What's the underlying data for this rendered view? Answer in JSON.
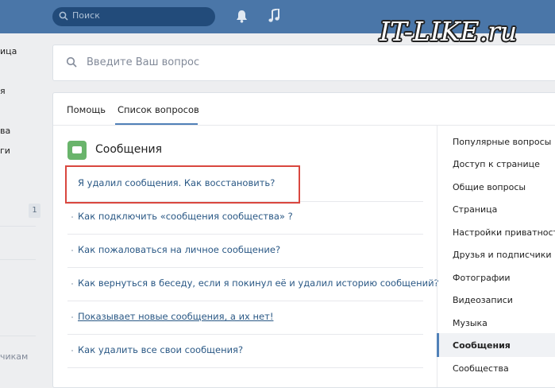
{
  "header": {
    "search_placeholder": "Поиск",
    "icons": [
      "search-icon",
      "bell-icon",
      "music-icon"
    ],
    "watermark": "IT-LIKE.ru"
  },
  "leftnav": {
    "fragments": [
      "ица",
      "я",
      "ва",
      "ги",
      "чикам"
    ],
    "badge": "1"
  },
  "help_search": {
    "placeholder": "Введите Ваш вопрос"
  },
  "tabs": [
    {
      "label": "Помощь"
    },
    {
      "label": "Список вопросов"
    }
  ],
  "section": {
    "title": "Сообщения",
    "questions": [
      "Я удалил сообщения. Как восстановить?",
      "Как подключить «сообщения сообщества» ?",
      "Как пожаловаться на личное сообщение?",
      "Как вернуться в беседу, если я покинул её и удалил историю сообщений?",
      "Показывает новые сообщения, а их нет!",
      "Как удалить все свои сообщения?"
    ]
  },
  "categories": [
    "Популярные вопросы",
    "Доступ к странице",
    "Общие вопросы",
    "Страница",
    "Настройки приватности",
    "Друзья и подписчики",
    "Фотографии",
    "Видеозаписи",
    "Музыка",
    "Сообщения",
    "Сообщества"
  ],
  "colors": {
    "topbar": "#4a76a8",
    "link": "#2a5885",
    "highlight": "#d9473f",
    "section_icon": "#69b46b"
  }
}
